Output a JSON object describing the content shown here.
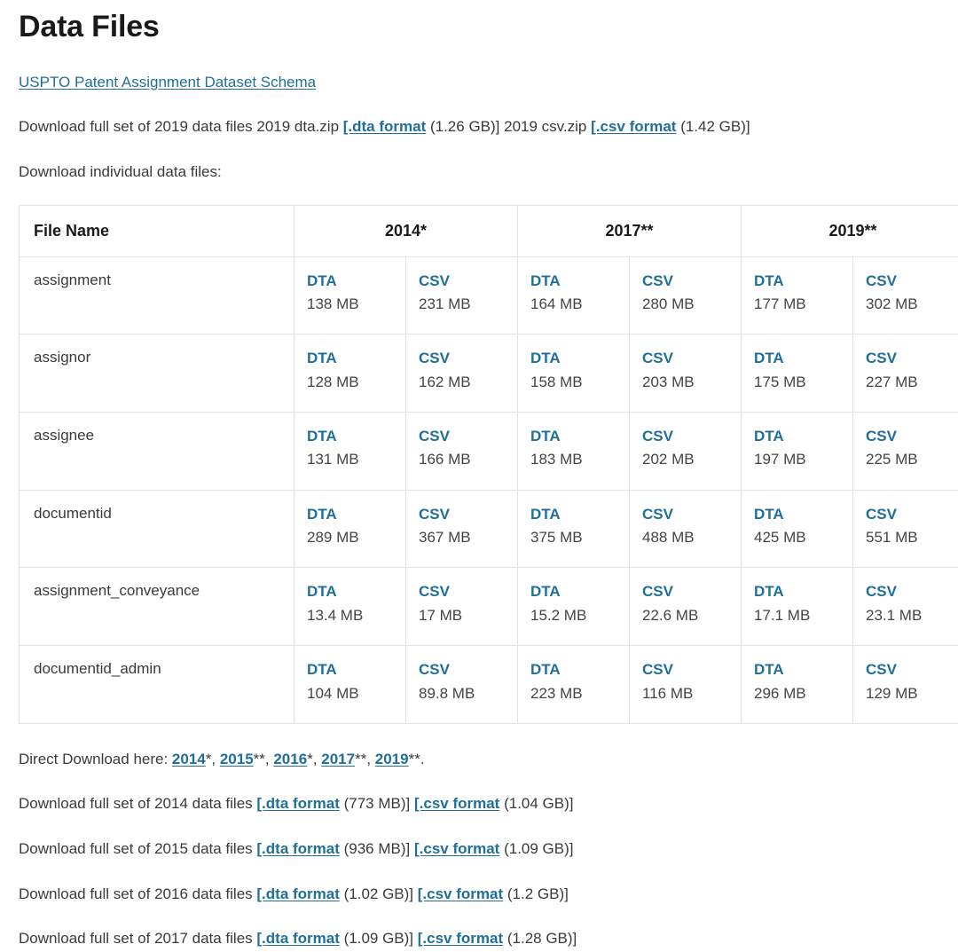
{
  "header": {
    "title": "Data Files",
    "schema_link": "USPTO Patent Assignment Dataset Schema"
  },
  "intro": {
    "full_set_prefix": "Download full set of 2019 data files 2019 dta.zip ",
    "dta_link": "[.dta format",
    "dta_size": " (1.26 GB)] ",
    "csv_zip_label": "2019 csv.zip ",
    "csv_link": "[.csv format",
    "csv_size": " (1.42 GB)]",
    "individual_label": "Download individual data files:"
  },
  "table": {
    "filename_header": "File Name",
    "year_headers": [
      "2014*",
      "2017**",
      "2019**"
    ],
    "format_labels": [
      "DTA",
      "CSV"
    ],
    "rows": [
      {
        "name": "assignment",
        "cells": [
          {
            "format": "DTA",
            "size": "138 MB"
          },
          {
            "format": "CSV",
            "size": "231 MB"
          },
          {
            "format": "DTA",
            "size": "164 MB"
          },
          {
            "format": "CSV",
            "size": "280 MB"
          },
          {
            "format": "DTA",
            "size": "177 MB"
          },
          {
            "format": "CSV",
            "size": "302 MB"
          }
        ]
      },
      {
        "name": "assignor",
        "cells": [
          {
            "format": "DTA",
            "size": "128 MB"
          },
          {
            "format": "CSV",
            "size": "162 MB"
          },
          {
            "format": "DTA",
            "size": "158 MB"
          },
          {
            "format": "CSV",
            "size": "203 MB"
          },
          {
            "format": "DTA",
            "size": "175 MB"
          },
          {
            "format": "CSV",
            "size": "227 MB"
          }
        ]
      },
      {
        "name": "assignee",
        "cells": [
          {
            "format": "DTA",
            "size": "131 MB"
          },
          {
            "format": "CSV",
            "size": "166 MB"
          },
          {
            "format": "DTA",
            "size": "183 MB"
          },
          {
            "format": "CSV",
            "size": "202 MB"
          },
          {
            "format": "DTA",
            "size": "197 MB"
          },
          {
            "format": "CSV",
            "size": "225 MB"
          }
        ]
      },
      {
        "name": "documentid",
        "cells": [
          {
            "format": "DTA",
            "size": "289 MB"
          },
          {
            "format": "CSV",
            "size": "367 MB"
          },
          {
            "format": "DTA",
            "size": "375 MB"
          },
          {
            "format": "CSV",
            "size": "488 MB"
          },
          {
            "format": "DTA",
            "size": "425 MB"
          },
          {
            "format": "CSV",
            "size": "551 MB"
          }
        ]
      },
      {
        "name": "assignment_conveyance",
        "cells": [
          {
            "format": "DTA",
            "size": "13.4 MB"
          },
          {
            "format": "CSV",
            "size": "17 MB"
          },
          {
            "format": "DTA",
            "size": "15.2 MB"
          },
          {
            "format": "CSV",
            "size": "22.6 MB"
          },
          {
            "format": "DTA",
            "size": "17.1 MB"
          },
          {
            "format": "CSV",
            "size": "23.1 MB"
          }
        ]
      },
      {
        "name": "documentid_admin",
        "cells": [
          {
            "format": "DTA",
            "size": "104 MB"
          },
          {
            "format": "CSV",
            "size": "89.8 MB"
          },
          {
            "format": "DTA",
            "size": "223 MB"
          },
          {
            "format": "CSV",
            "size": "116 MB"
          },
          {
            "format": "DTA",
            "size": "296 MB"
          },
          {
            "format": "CSV",
            "size": "129 MB"
          }
        ]
      }
    ]
  },
  "direct_download": {
    "label": "Direct Download here: ",
    "years": [
      {
        "year": "2014",
        "stars": "*",
        "sep": ", "
      },
      {
        "year": "2015",
        "stars": "**",
        "sep": ", "
      },
      {
        "year": "2016",
        "stars": "*",
        "sep": ", "
      },
      {
        "year": "2017",
        "stars": "**",
        "sep": ", "
      },
      {
        "year": "2019",
        "stars": "**",
        "sep": "."
      }
    ]
  },
  "full_sets": [
    {
      "prefix": "Download full set of 2014 data files ",
      "dta_link": "[.dta format",
      "dta_size": " (773 MB)] ",
      "csv_link": "[.csv format",
      "csv_size": " (1.04 GB)]"
    },
    {
      "prefix": "Download full set of 2015 data files ",
      "dta_link": "[.dta format",
      "dta_size": " (936 MB)] ",
      "csv_link": "[.csv format",
      "csv_size": " (1.09 GB)]"
    },
    {
      "prefix": "Download full set of 2016 data files ",
      "dta_link": "[.dta format",
      "dta_size": " (1.02 GB)] ",
      "csv_link": "[.csv format",
      "csv_size": " (1.2 GB)]"
    },
    {
      "prefix": "Download full set of 2017 data files ",
      "dta_link": "[.dta format",
      "dta_size": " (1.09 GB)] ",
      "csv_link": "[.csv format",
      "csv_size": " (1.28 GB)]"
    }
  ],
  "colors": {
    "link": "#1f6f9a",
    "heading": "#1a1a1a",
    "body_text": "#3a3a3a",
    "border": "#e3e3e3",
    "size_text": "#444444"
  }
}
